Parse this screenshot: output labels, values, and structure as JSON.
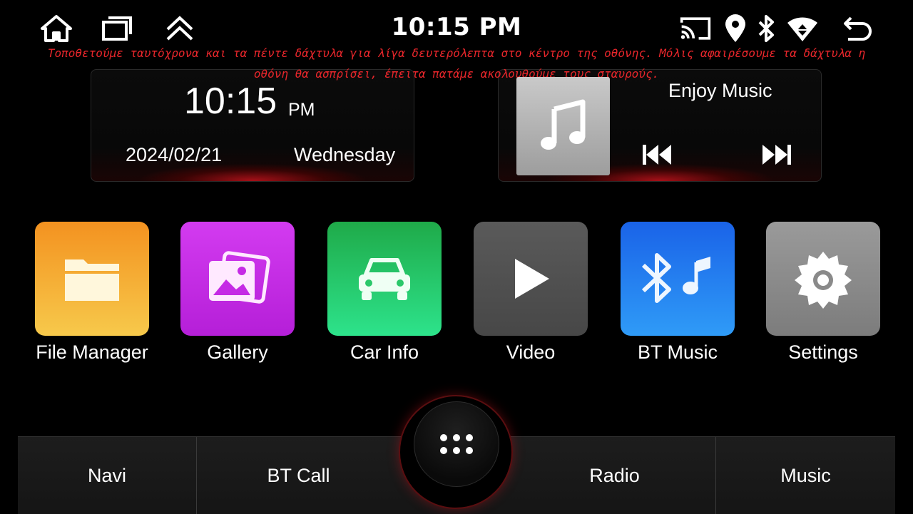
{
  "status_bar": {
    "time": "10:15 PM",
    "left_icons": [
      "home-icon",
      "recent-apps-icon",
      "collapse-up-icon"
    ],
    "right_icons": [
      "screen-cast-icon",
      "location-icon",
      "bluetooth-icon",
      "wifi-icon",
      "back-icon"
    ]
  },
  "overlay": {
    "instruction": "Τοποθετούμε ταυτόχρονα και τα πέντε δάχτυλα για λίγα δευτερόλεπτα στο κέντρο της οθόνης. Μόλις αφαιρέσουμε τα δάχτυλα η οθόνη θα ασπρίσει, έπειτα πατάμε ακολουθούμε τους σταυρούς.",
    "color": "#e8262b"
  },
  "clock_widget": {
    "time": "10:15",
    "ampm": "PM",
    "date": "2024/02/21",
    "weekday": "Wednesday"
  },
  "music_widget": {
    "title": "Enjoy Music",
    "album_icon": "music-note-icon",
    "prev_icon": "skip-previous-icon",
    "next_icon": "skip-next-icon"
  },
  "apps": [
    {
      "label": "File Manager",
      "icon": "folder-icon",
      "color": "#f5a021"
    },
    {
      "label": "Gallery",
      "icon": "gallery-icon",
      "color": "#c323e3"
    },
    {
      "label": "Car Info",
      "icon": "car-icon",
      "color": "#22c65c"
    },
    {
      "label": "Video",
      "icon": "play-icon",
      "color": "#555555"
    },
    {
      "label": "BT Music",
      "icon": "bluetooth-music-icon",
      "color": "#1f74f0"
    },
    {
      "label": "Settings",
      "icon": "gear-icon",
      "color": "#8a8a8a"
    }
  ],
  "dock": {
    "items": [
      "Navi",
      "BT Call",
      "Radio",
      "Music"
    ],
    "center_icon": "app-drawer-icon",
    "accent": "#d0141e"
  }
}
